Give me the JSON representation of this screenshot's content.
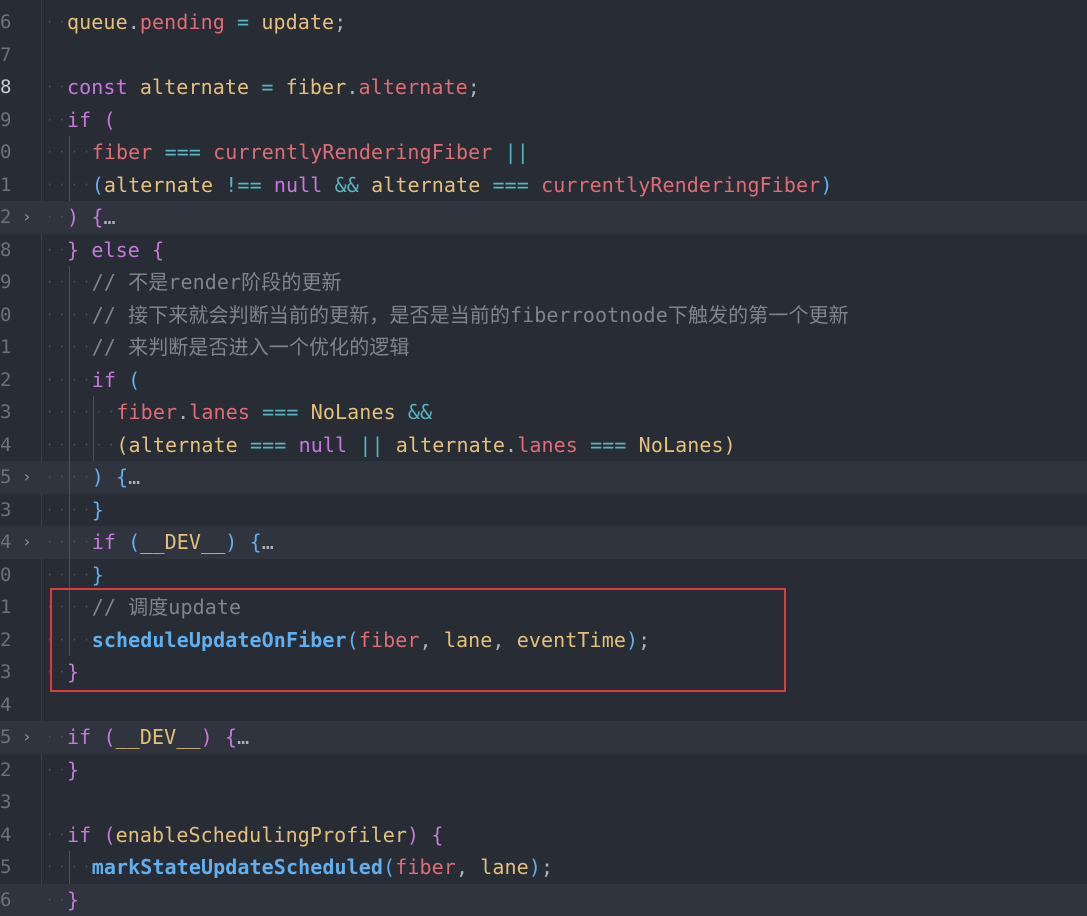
{
  "editor": {
    "lines": [
      {
        "num": "6",
        "tokens": [
          [
            "var",
            "queue"
          ],
          [
            "pn",
            "."
          ],
          [
            "prop",
            "pending"
          ],
          [
            "pn",
            " "
          ],
          [
            "op",
            "="
          ],
          [
            "pn",
            " "
          ],
          [
            "var",
            "update"
          ],
          [
            "pn",
            ";"
          ]
        ],
        "indent": 1
      },
      {
        "num": "7",
        "tokens": [],
        "indent": 0
      },
      {
        "num": "8",
        "tokens": [
          [
            "kw",
            "const"
          ],
          [
            "pn",
            " "
          ],
          [
            "var",
            "alternate"
          ],
          [
            "pn",
            " "
          ],
          [
            "op",
            "="
          ],
          [
            "pn",
            " "
          ],
          [
            "var",
            "fiber"
          ],
          [
            "pn",
            "."
          ],
          [
            "prop",
            "alternate"
          ],
          [
            "pn",
            ";"
          ]
        ],
        "indent": 1,
        "current": true
      },
      {
        "num": "9",
        "tokens": [
          [
            "kw",
            "if"
          ],
          [
            "pn",
            " "
          ],
          [
            "paren",
            "("
          ]
        ],
        "indent": 1
      },
      {
        "num": "0",
        "tokens": [
          [
            "prop",
            "fiber"
          ],
          [
            "pn",
            " "
          ],
          [
            "op",
            "==="
          ],
          [
            "pn",
            " "
          ],
          [
            "prop",
            "currentlyRenderingFiber"
          ],
          [
            "pn",
            " "
          ],
          [
            "op",
            "||"
          ]
        ],
        "indent": 2
      },
      {
        "num": "1",
        "tokens": [
          [
            "paren2",
            "("
          ],
          [
            "var",
            "alternate"
          ],
          [
            "pn",
            " "
          ],
          [
            "op",
            "!=="
          ],
          [
            "pn",
            " "
          ],
          [
            "kw2",
            "null"
          ],
          [
            "pn",
            " "
          ],
          [
            "op",
            "&&"
          ],
          [
            "pn",
            " "
          ],
          [
            "var",
            "alternate"
          ],
          [
            "pn",
            " "
          ],
          [
            "op",
            "==="
          ],
          [
            "pn",
            " "
          ],
          [
            "prop",
            "currentlyRenderingFiber"
          ],
          [
            "paren2",
            ")"
          ]
        ],
        "indent": 2
      },
      {
        "num": "2",
        "tokens": [
          [
            "paren",
            ")"
          ],
          [
            "pn",
            " "
          ],
          [
            "paren",
            "{"
          ],
          [
            "fd",
            "…"
          ]
        ],
        "indent": 1,
        "fold": true,
        "hl": true
      },
      {
        "num": "8",
        "tokens": [
          [
            "paren",
            "}"
          ],
          [
            "pn",
            " "
          ],
          [
            "kw",
            "else"
          ],
          [
            "pn",
            " "
          ],
          [
            "paren",
            "{"
          ]
        ],
        "indent": 1
      },
      {
        "num": "9",
        "tokens": [
          [
            "cm",
            "// 不是render阶段的更新"
          ]
        ],
        "indent": 2
      },
      {
        "num": "0",
        "tokens": [
          [
            "cm",
            "// 接下来就会判断当前的更新，是否是当前的fiberrootnode下触发的第一个更新"
          ]
        ],
        "indent": 2
      },
      {
        "num": "1",
        "tokens": [
          [
            "cm",
            "// 来判断是否进入一个优化的逻辑"
          ]
        ],
        "indent": 2
      },
      {
        "num": "2",
        "tokens": [
          [
            "kw",
            "if"
          ],
          [
            "pn",
            " "
          ],
          [
            "paren2",
            "("
          ]
        ],
        "indent": 2
      },
      {
        "num": "3",
        "tokens": [
          [
            "prop",
            "fiber"
          ],
          [
            "pn",
            "."
          ],
          [
            "prop",
            "lanes"
          ],
          [
            "pn",
            " "
          ],
          [
            "op",
            "==="
          ],
          [
            "pn",
            " "
          ],
          [
            "const",
            "NoLanes"
          ],
          [
            "pn",
            " "
          ],
          [
            "op",
            "&&"
          ]
        ],
        "indent": 3
      },
      {
        "num": "4",
        "tokens": [
          [
            "paren3",
            "("
          ],
          [
            "var",
            "alternate"
          ],
          [
            "pn",
            " "
          ],
          [
            "op",
            "==="
          ],
          [
            "pn",
            " "
          ],
          [
            "kw2",
            "null"
          ],
          [
            "pn",
            " "
          ],
          [
            "op",
            "||"
          ],
          [
            "pn",
            " "
          ],
          [
            "var",
            "alternate"
          ],
          [
            "pn",
            "."
          ],
          [
            "prop",
            "lanes"
          ],
          [
            "pn",
            " "
          ],
          [
            "op",
            "==="
          ],
          [
            "pn",
            " "
          ],
          [
            "const",
            "NoLanes"
          ],
          [
            "paren3",
            ")"
          ]
        ],
        "indent": 3
      },
      {
        "num": "5",
        "tokens": [
          [
            "paren2",
            ")"
          ],
          [
            "pn",
            " "
          ],
          [
            "paren2",
            "{"
          ],
          [
            "fd",
            "…"
          ]
        ],
        "indent": 2,
        "fold": true,
        "hl": true
      },
      {
        "num": "3",
        "tokens": [
          [
            "paren2",
            "}"
          ]
        ],
        "indent": 2
      },
      {
        "num": "4",
        "tokens": [
          [
            "kw",
            "if"
          ],
          [
            "pn",
            " "
          ],
          [
            "paren2",
            "("
          ],
          [
            "const",
            "__DEV__"
          ],
          [
            "paren2",
            ")"
          ],
          [
            "pn",
            " "
          ],
          [
            "paren2",
            "{"
          ],
          [
            "fd",
            "…"
          ]
        ],
        "indent": 2,
        "fold": true,
        "hl": true
      },
      {
        "num": "0",
        "tokens": [
          [
            "paren2",
            "}"
          ]
        ],
        "indent": 2
      },
      {
        "num": "1",
        "tokens": [
          [
            "cm",
            "// 调度update"
          ]
        ],
        "indent": 2
      },
      {
        "num": "2",
        "tokens": [
          [
            "fn",
            "scheduleUpdateOnFiber"
          ],
          [
            "paren2",
            "("
          ],
          [
            "prop",
            "fiber"
          ],
          [
            "pn",
            ", "
          ],
          [
            "var",
            "lane"
          ],
          [
            "pn",
            ", "
          ],
          [
            "var",
            "eventTime"
          ],
          [
            "paren2",
            ")"
          ],
          [
            "pn",
            ";"
          ]
        ],
        "indent": 2
      },
      {
        "num": "3",
        "tokens": [
          [
            "paren",
            "}"
          ]
        ],
        "indent": 1
      },
      {
        "num": "4",
        "tokens": [],
        "indent": 0
      },
      {
        "num": "5",
        "tokens": [
          [
            "kw",
            "if"
          ],
          [
            "pn",
            " "
          ],
          [
            "paren",
            "("
          ],
          [
            "const",
            "__DEV__"
          ],
          [
            "paren",
            ")"
          ],
          [
            "pn",
            " "
          ],
          [
            "paren",
            "{"
          ],
          [
            "fd",
            "…"
          ]
        ],
        "indent": 1,
        "fold": true,
        "hl": true
      },
      {
        "num": "2",
        "tokens": [
          [
            "paren",
            "}"
          ]
        ],
        "indent": 1
      },
      {
        "num": "3",
        "tokens": [],
        "indent": 0
      },
      {
        "num": "4",
        "tokens": [
          [
            "kw",
            "if"
          ],
          [
            "pn",
            " "
          ],
          [
            "paren",
            "("
          ],
          [
            "var",
            "enableSchedulingProfiler"
          ],
          [
            "paren",
            ")"
          ],
          [
            "pn",
            " "
          ],
          [
            "paren",
            "{"
          ]
        ],
        "indent": 1
      },
      {
        "num": "5",
        "tokens": [
          [
            "fn",
            "markStateUpdateScheduled"
          ],
          [
            "paren2",
            "("
          ],
          [
            "prop",
            "fiber"
          ],
          [
            "pn",
            ", "
          ],
          [
            "var",
            "lane"
          ],
          [
            "paren2",
            ")"
          ],
          [
            "pn",
            ";"
          ]
        ],
        "indent": 2
      },
      {
        "num": "6",
        "tokens": [
          [
            "paren",
            "}"
          ]
        ],
        "indent": 1,
        "hl": true
      }
    ]
  },
  "colors": {
    "background": "#282c34",
    "highlight_box": "#e03a3a"
  }
}
